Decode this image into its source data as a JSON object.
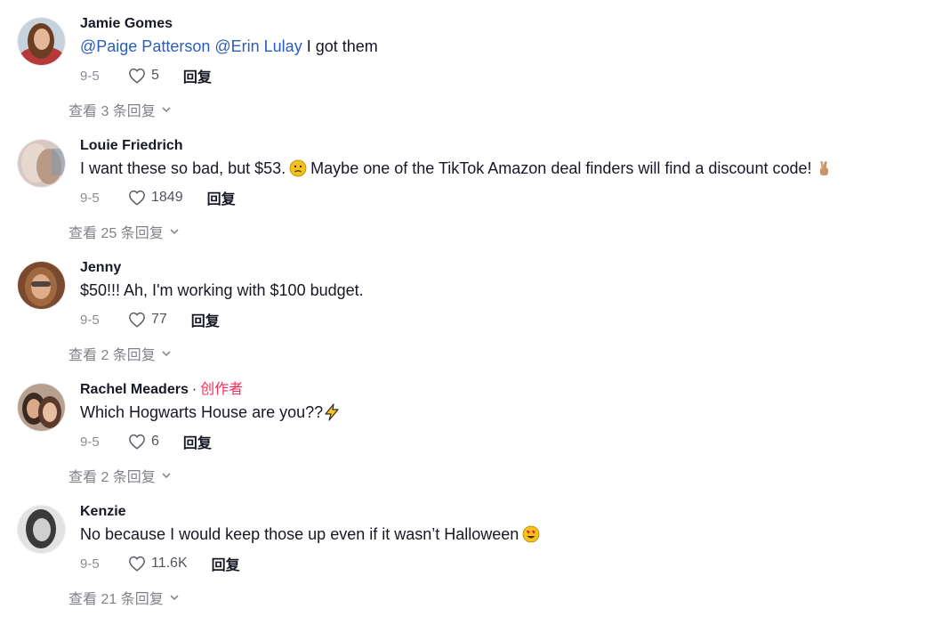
{
  "comments": [
    {
      "username": "Jamie Gomes",
      "mentions": [
        "@Paige Patterson",
        "@Erin Lulay"
      ],
      "text": "I got them",
      "date": "9-5",
      "likes": "5",
      "reply_label": "回复",
      "view_replies": "查看 3 条回复",
      "avatar_bg": "#c7d3dc"
    },
    {
      "username": "Louie Friedrich",
      "text": "I want these so bad, but $53.",
      "text2": "Maybe one of the TikTok Amazon deal finders will find a discount code!",
      "emoji1": "slightly-frowning-face",
      "emoji2": "crossed-fingers",
      "date": "9-5",
      "likes": "1849",
      "reply_label": "回复",
      "view_replies": "查看 25 条回复",
      "avatar_bg": "#d8c8c4"
    },
    {
      "username": "Jenny",
      "text": "$50!!! Ah, I'm working with $100 budget.",
      "date": "9-5",
      "likes": "77",
      "reply_label": "回复",
      "view_replies": "查看 2 条回复",
      "avatar_bg": "#8a5a3c"
    },
    {
      "username": "Rachel Meaders",
      "creator_separator": "·",
      "creator_badge": "创作者",
      "text": "Which Hogwarts House are you??",
      "emoji1": "lightning-bolt",
      "date": "9-5",
      "likes": "6",
      "reply_label": "回复",
      "view_replies": "查看 2 条回复",
      "avatar_bg": "#a48778"
    },
    {
      "username": "Kenzie",
      "text": "No because I would keep those up even if it wasn’t Halloween",
      "emoji1": "heart-eyes",
      "date": "9-5",
      "likes": "11.6K",
      "reply_label": "回复",
      "view_replies": "查看 21 条回复",
      "avatar_bg": "#d6d6d6"
    }
  ],
  "colors": {
    "text": "#161823",
    "mention": "#2b5db9",
    "creator": "#fe2c55",
    "muted": "#8a8b91"
  }
}
